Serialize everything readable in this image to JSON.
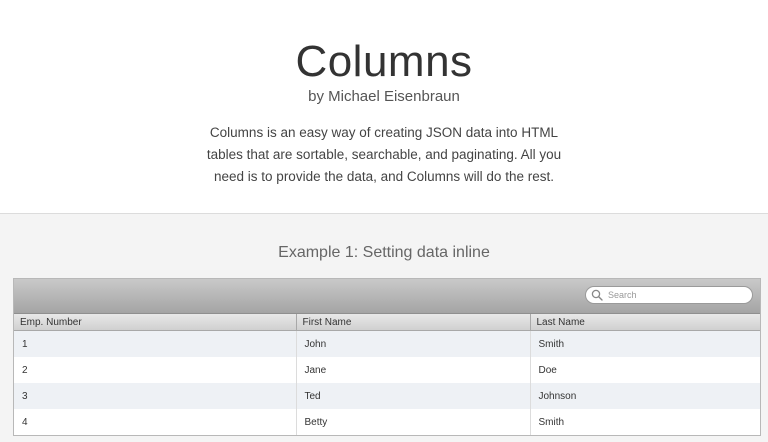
{
  "header": {
    "title": "Columns",
    "byline": "by Michael Eisenbraun",
    "description": "Columns is an easy way of creating JSON data into HTML tables that are sortable, searchable, and paginating. All you need is to provide the data, and Columns will do the rest."
  },
  "example": {
    "title": "Example 1: Setting data inline",
    "search": {
      "placeholder": "Search",
      "value": "",
      "icon": "search-icon"
    },
    "columns": [
      "Emp. Number",
      "First Name",
      "Last Name"
    ],
    "rows": [
      [
        "1",
        "John",
        "Smith"
      ],
      [
        "2",
        "Jane",
        "Doe"
      ],
      [
        "3",
        "Ted",
        "Johnson"
      ],
      [
        "4",
        "Betty",
        "Smith"
      ]
    ]
  },
  "colors": {
    "background": "#f4f4f4",
    "toolbar": "#a4a4a4",
    "row_alt": "#eef1f5"
  }
}
